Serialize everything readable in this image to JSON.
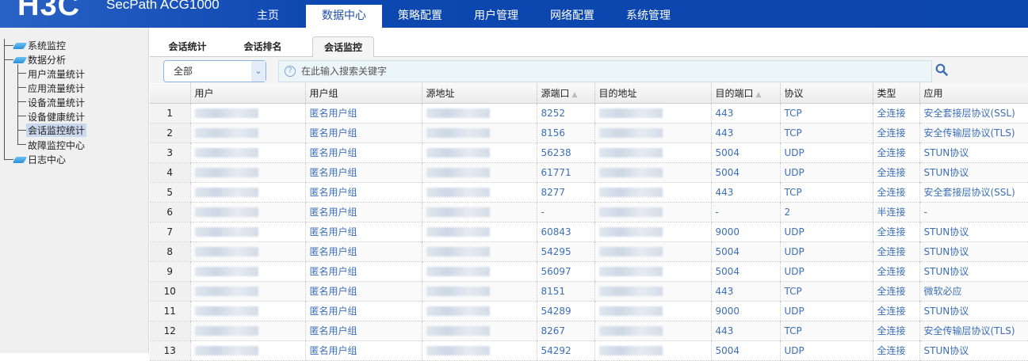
{
  "header": {
    "logo": "H3C",
    "product": "SecPath ACG1000",
    "nav": [
      "主页",
      "数据中心",
      "策略配置",
      "用户管理",
      "网络配置",
      "系统管理"
    ],
    "active_nav": 1
  },
  "sidebar": {
    "groups": [
      "系统监控",
      "数据分析",
      "日志中心"
    ],
    "items": [
      "用户流量统计",
      "应用流量统计",
      "设备流量统计",
      "设备健康统计",
      "会话监控统计",
      "故障监控中心"
    ],
    "selected": "会话监控统计"
  },
  "tabs": [
    "会话统计",
    "会话排名",
    "会话监控"
  ],
  "toolbar": {
    "filter": "全部",
    "search_placeholder": "在此输入搜索关键字"
  },
  "table": {
    "headers": [
      "",
      "用户",
      "用户组",
      "源地址",
      "源端口",
      "目的地址",
      "目的端口",
      "协议",
      "类型",
      "应用"
    ],
    "rows": [
      [
        "1",
        "",
        "匿名用户组",
        "",
        "8252",
        "",
        "443",
        "TCP",
        "全连接",
        "安全套接层协议(SSL)"
      ],
      [
        "2",
        "",
        "匿名用户组",
        "",
        "8156",
        "",
        "443",
        "TCP",
        "全连接",
        "安全传输层协议(TLS)"
      ],
      [
        "3",
        "",
        "匿名用户组",
        "",
        "56238",
        "",
        "5004",
        "UDP",
        "全连接",
        "STUN协议"
      ],
      [
        "4",
        "",
        "匿名用户组",
        "",
        "61771",
        "",
        "5004",
        "UDP",
        "全连接",
        "STUN协议"
      ],
      [
        "5",
        "",
        "匿名用户组",
        "",
        "8277",
        "",
        "443",
        "TCP",
        "全连接",
        "安全套接层协议(SSL)"
      ],
      [
        "6",
        "",
        "匿名用户组",
        "",
        "-",
        "",
        "-",
        "2",
        "半连接",
        "-"
      ],
      [
        "7",
        "",
        "匿名用户组",
        "",
        "60843",
        "",
        "9000",
        "UDP",
        "全连接",
        "STUN协议"
      ],
      [
        "8",
        "",
        "匿名用户组",
        "",
        "54295",
        "",
        "5004",
        "UDP",
        "全连接",
        "STUN协议"
      ],
      [
        "9",
        "",
        "匿名用户组",
        "",
        "56097",
        "",
        "5004",
        "UDP",
        "全连接",
        "STUN协议"
      ],
      [
        "10",
        "",
        "匿名用户组",
        "",
        "8151",
        "",
        "443",
        "TCP",
        "全连接",
        "微软必应"
      ],
      [
        "11",
        "",
        "匿名用户组",
        "",
        "54289",
        "",
        "9000",
        "UDP",
        "全连接",
        "STUN协议"
      ],
      [
        "12",
        "",
        "匿名用户组",
        "",
        "8267",
        "",
        "443",
        "TCP",
        "全连接",
        "安全传输层协议(TLS)"
      ],
      [
        "13",
        "",
        "匿名用户组",
        "",
        "54292",
        "",
        "5004",
        "UDP",
        "全连接",
        "STUN协议"
      ]
    ]
  }
}
